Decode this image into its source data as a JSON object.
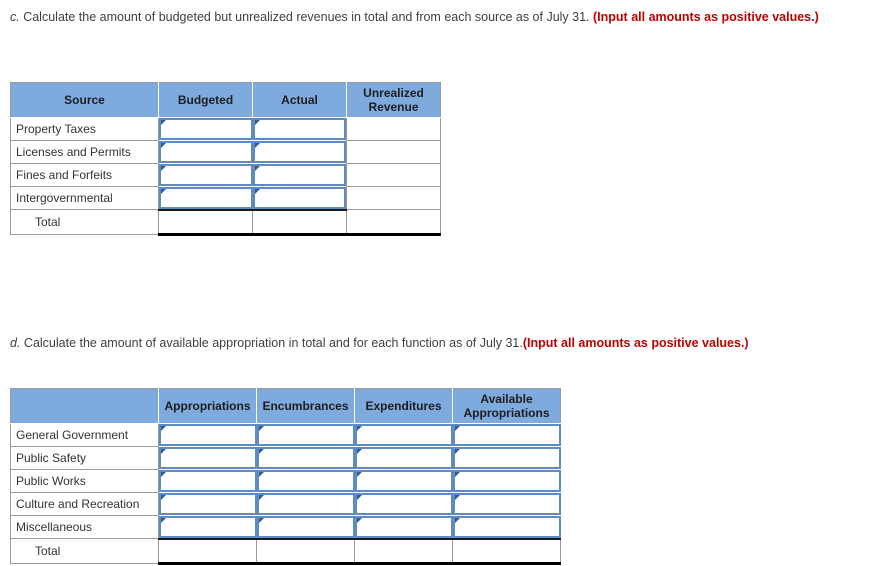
{
  "colors": {
    "header_blue": "#7EAADE",
    "input_border_blue": "#5E8CC0",
    "hint_red": "#c00000",
    "grid_gray": "#9a9a9a",
    "total_rule_black": "#000000"
  },
  "prompt_c": {
    "letter": "c.",
    "text": " Calculate the amount of budgeted but unrealized revenues in total and from each source as of July 31. ",
    "hint": "(Input all amounts as positive values.)"
  },
  "prompt_d": {
    "letter": "d.",
    "text": " Calculate the amount of available appropriation in total and for each function as of July 31.",
    "hint": "(Input all amounts as positive values.)"
  },
  "table_revenues": {
    "name": "budgeted-unrealized-revenues-table",
    "columns": [
      {
        "label": "Source",
        "type": "label"
      },
      {
        "label": "Budgeted",
        "type": "input"
      },
      {
        "label": "Actual",
        "type": "input"
      },
      {
        "label": "Unrealized Revenue",
        "type": "computed"
      }
    ],
    "rows": [
      {
        "label": "Property Taxes",
        "budgeted": "",
        "actual": "",
        "unrealized": ""
      },
      {
        "label": "Licenses and Permits",
        "budgeted": "",
        "actual": "",
        "unrealized": ""
      },
      {
        "label": "Fines and Forfeits",
        "budgeted": "",
        "actual": "",
        "unrealized": ""
      },
      {
        "label": "Intergovernmental",
        "budgeted": "",
        "actual": "",
        "unrealized": ""
      }
    ],
    "total_row": {
      "label": "Total",
      "budgeted": "",
      "actual": "",
      "unrealized": ""
    }
  },
  "table_appropriations": {
    "name": "available-appropriations-table",
    "columns": [
      {
        "label": "",
        "type": "label"
      },
      {
        "label": "Appropriations",
        "type": "input"
      },
      {
        "label": "Encumbrances",
        "type": "input"
      },
      {
        "label": "Expenditures",
        "type": "input"
      },
      {
        "label": "Available Appropriations",
        "type": "input"
      }
    ],
    "rows": [
      {
        "label": "General Government",
        "appropriations": "",
        "encumbrances": "",
        "expenditures": "",
        "available": ""
      },
      {
        "label": "Public Safety",
        "appropriations": "",
        "encumbrances": "",
        "expenditures": "",
        "available": ""
      },
      {
        "label": "Public Works",
        "appropriations": "",
        "encumbrances": "",
        "expenditures": "",
        "available": ""
      },
      {
        "label": "Culture and Recreation",
        "appropriations": "",
        "encumbrances": "",
        "expenditures": "",
        "available": ""
      },
      {
        "label": "Miscellaneous",
        "appropriations": "",
        "encumbrances": "",
        "expenditures": "",
        "available": ""
      }
    ],
    "total_row": {
      "label": "Total",
      "appropriations": "",
      "encumbrances": "",
      "expenditures": "",
      "available": ""
    }
  }
}
